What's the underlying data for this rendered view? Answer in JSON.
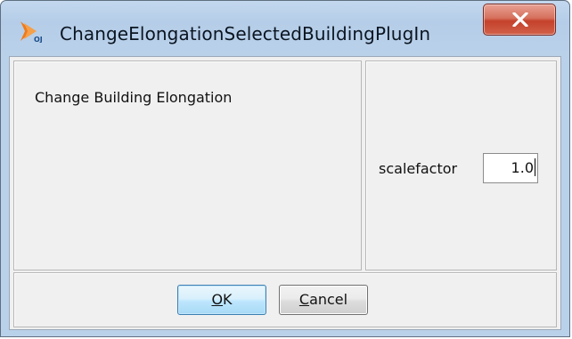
{
  "window": {
    "title": "ChangeElongationSelectedBuildingPlugIn",
    "app_icon": "openjump-icon",
    "close_icon": "close-x-icon"
  },
  "description": {
    "text": "Change Building Elongation"
  },
  "parameters": {
    "scalefactor": {
      "label": "scalefactor",
      "value": "1.0"
    }
  },
  "buttons": {
    "ok": {
      "mnemonic": "O",
      "rest": "K"
    },
    "cancel": {
      "mnemonic": "C",
      "rest": "ancel"
    }
  },
  "colors": {
    "close_button": "#c4412b",
    "default_button_border": "#3c7fb1",
    "dialog_background": "#f0f0f0"
  }
}
